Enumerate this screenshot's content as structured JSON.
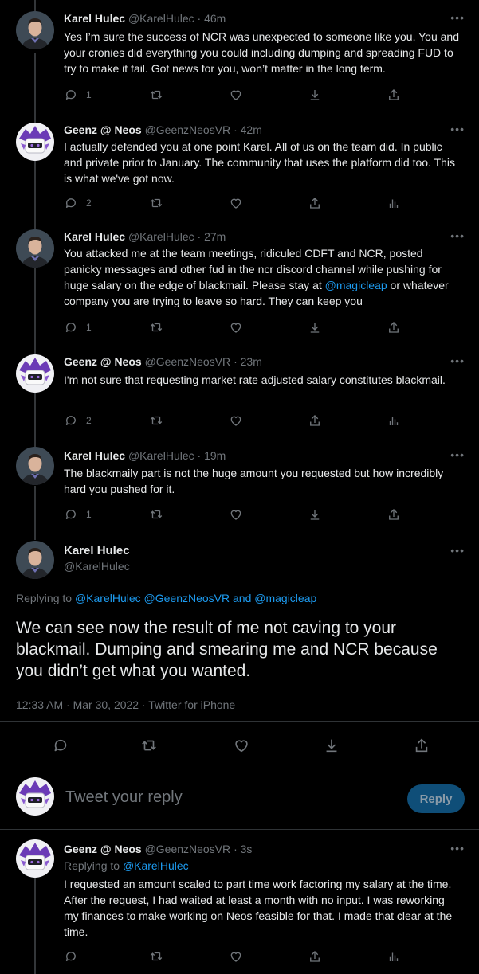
{
  "tweets": [
    {
      "name": "Karel Hulec",
      "handle": "@KarelHulec",
      "time": "46m",
      "text": "Yes I’m sure the success of NCR was unexpected to someone like you. You and your cronies did everything you could including dumping and spreading FUD to try to make it fail. Got news for you, won’t matter in the long term.",
      "reply_count": "1"
    },
    {
      "name": "Geenz @ Neos",
      "handle": "@GeenzNeosVR",
      "time": "42m",
      "text": "I actually defended you at one point Karel.  All of us on the team did.  In public and private prior to January.  The community that uses the platform did too.  This is what we've got now.",
      "reply_count": "2"
    },
    {
      "name": "Karel Hulec",
      "handle": "@KarelHulec",
      "time": "27m",
      "text_before": "You attacked me at the team meetings, ridiculed CDFT and NCR, posted panicky messages and other fud in the ncr discord channel while pushing for huge salary on the edge of blackmail. Please stay at ",
      "mention": "@magicleap",
      "text_after": " or whatever company you are trying to leave so hard. They can keep you",
      "reply_count": "1"
    },
    {
      "name": "Geenz @ Neos",
      "handle": "@GeenzNeosVR",
      "time": "23m",
      "text": "I'm not sure that requesting market rate adjusted salary constitutes blackmail.",
      "reply_count": "2"
    },
    {
      "name": "Karel Hulec",
      "handle": "@KarelHulec",
      "time": "19m",
      "text": "The blackmaily part is not the huge amount you requested but how incredibly hard you pushed for it.",
      "reply_count": "1"
    }
  ],
  "main": {
    "name": "Karel Hulec",
    "handle": "@KarelHulec",
    "replying_prefix": "Replying to ",
    "replying_1": "@KarelHulec",
    "replying_2": "@GeenzNeosVR",
    "replying_and": "and",
    "replying_3": "@magicleap",
    "text": "We can see now the result of me not caving to your blackmail. Dumping and smearing me and NCR because you didn’t get what you wanted.",
    "meta": "12:33 AM · Mar 30, 2022 · Twitter for iPhone"
  },
  "composer": {
    "placeholder": "Tweet your reply",
    "reply_label": "Reply"
  },
  "last": {
    "name": "Geenz @ Neos",
    "handle": "@GeenzNeosVR",
    "time": "3s",
    "replying_prefix": "Replying to ",
    "replying_to": "@KarelHulec",
    "text": "I requested an amount scaled to part time work factoring my salary at the time.  After the request, I had waited at least a month with no input. I was reworking my finances to make working on Neos feasible for that. I made that clear at the time."
  },
  "ui": {
    "dot": "·",
    "more": "•••"
  },
  "colors": {
    "accent": "#1d9bf0",
    "reply_button": "#0f4e78",
    "background": "#000000"
  }
}
